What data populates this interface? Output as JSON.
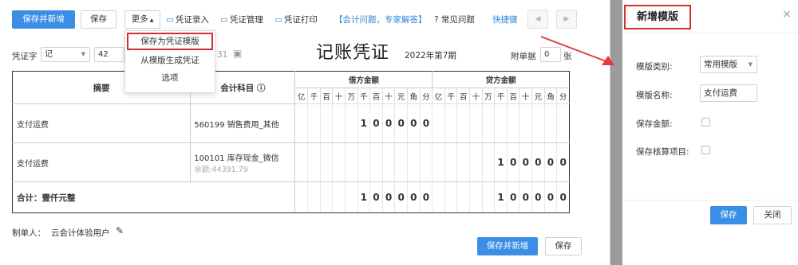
{
  "toolbar": {
    "save_new": "保存并新增",
    "save": "保存",
    "more": "更多",
    "voucher_entry": "凭证录入",
    "voucher_manage": "凭证管理",
    "voucher_print": "凭证打印",
    "expert": "【会计问题，专家解答】",
    "faq": "常见问题",
    "shortcut": "快捷键"
  },
  "menu": {
    "items": [
      "保存为凭证模版",
      "从模版生成凭证",
      "选项"
    ]
  },
  "header": {
    "word_label": "凭证字",
    "word_value": "记",
    "number": "42",
    "date_tail": "31",
    "title": "记账凭证",
    "period": "2022年第7期",
    "attach_label": "附单据",
    "attach_value": "0",
    "attach_unit": "张"
  },
  "table": {
    "col_summary": "摘要",
    "col_account": "会计科目",
    "debit": "借方金额",
    "credit": "贷方金额",
    "digits": [
      "亿",
      "千",
      "百",
      "十",
      "万",
      "千",
      "百",
      "十",
      "元",
      "角",
      "分"
    ],
    "rows": [
      {
        "summary": "支付运费",
        "account": "560199 销售费用_其他",
        "balance": "",
        "debit": [
          "",
          "",
          "",
          "",
          "",
          "1",
          "0",
          "0",
          "0",
          "0",
          "0"
        ],
        "credit": [
          "",
          "",
          "",
          "",
          "",
          "",
          "",
          "",
          "",
          "",
          ""
        ]
      },
      {
        "summary": "支付运费",
        "account": "100101 库存现金_微信",
        "balance": "余额:44391.79",
        "debit": [
          "",
          "",
          "",
          "",
          "",
          "",
          "",
          "",
          "",
          "",
          ""
        ],
        "credit": [
          "",
          "",
          "",
          "",
          "",
          "1",
          "0",
          "0",
          "0",
          "0",
          "0"
        ]
      }
    ],
    "total_label": "合计：壹仟元整",
    "total_debit": [
      "",
      "",
      "",
      "",
      "",
      "1",
      "0",
      "0",
      "0",
      "0",
      "0"
    ],
    "total_credit": [
      "",
      "",
      "",
      "",
      "",
      "1",
      "0",
      "0",
      "0",
      "0",
      "0"
    ]
  },
  "footer": {
    "maker_label": "制单人：",
    "maker": "云会计体验用户",
    "save_new": "保存并新增",
    "save": "保存"
  },
  "panel": {
    "title": "新增模版",
    "type_label": "模版类别:",
    "type_value": "常用模版",
    "name_label": "模版名称:",
    "name_value": "支付运费",
    "amount_label": "保存金额:",
    "aux_label": "保存核算项目:",
    "save": "保存",
    "close": "关闭"
  },
  "colors": {
    "primary": "#3a8ee6",
    "highlight": "#d32f2f"
  }
}
